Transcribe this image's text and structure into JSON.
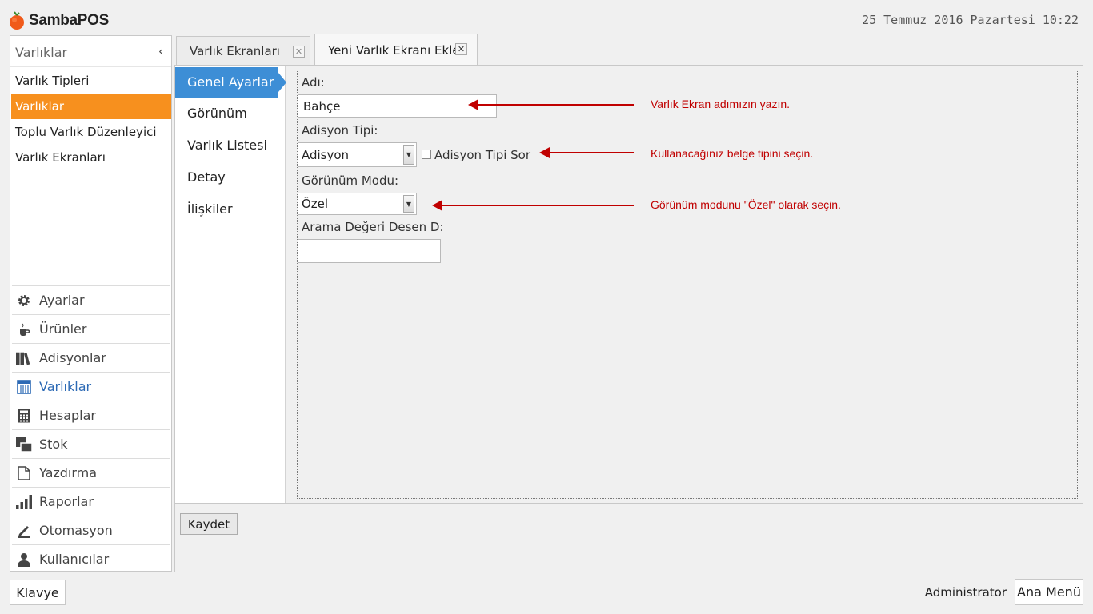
{
  "header": {
    "app_name": "SambaPOS",
    "datetime": "25 Temmuz 2016 Pazartesi 10:22"
  },
  "left_panel": {
    "title": "Varlıklar",
    "items": [
      {
        "label": "Varlık Tipleri",
        "active": false
      },
      {
        "label": "Varlıklar",
        "active": true
      },
      {
        "label": "Toplu Varlık Düzenleyici",
        "active": false
      },
      {
        "label": "Varlık Ekranları",
        "active": false
      }
    ],
    "nav": [
      {
        "label": "Ayarlar",
        "icon": "gear-icon"
      },
      {
        "label": "Ürünler",
        "icon": "cup-icon"
      },
      {
        "label": "Adisyonlar",
        "icon": "books-icon"
      },
      {
        "label": "Varlıklar",
        "icon": "table-icon",
        "active": true
      },
      {
        "label": "Hesaplar",
        "icon": "calculator-icon"
      },
      {
        "label": "Stok",
        "icon": "stock-icon"
      },
      {
        "label": "Yazdırma",
        "icon": "document-icon"
      },
      {
        "label": "Raporlar",
        "icon": "bar-chart-icon"
      },
      {
        "label": "Otomasyon",
        "icon": "pen-icon"
      },
      {
        "label": "Kullanıcılar",
        "icon": "user-icon"
      }
    ]
  },
  "tabs": [
    {
      "label": "Varlık Ekranları",
      "active": false
    },
    {
      "label": "Yeni Varlık Ekranı Ekle",
      "active": true
    }
  ],
  "subnav": [
    {
      "label": "Genel Ayarlar",
      "active": true
    },
    {
      "label": "Görünüm"
    },
    {
      "label": "Varlık Listesi"
    },
    {
      "label": "Detay"
    },
    {
      "label": "İlişkiler"
    }
  ],
  "form": {
    "name_label": "Adı:",
    "name_value": "Bahçe",
    "ticket_type_label": "Adisyon Tipi:",
    "ticket_type_value": "Adisyon",
    "ask_ticket_type_label": "Adisyon Tipi Sor",
    "ask_ticket_type_checked": false,
    "view_mode_label": "Görünüm Modu:",
    "view_mode_value": "Özel",
    "search_pattern_label": "Arama Değeri Desen D:",
    "search_pattern_value": ""
  },
  "annotations": [
    "Varlık Ekran adımızın yazın.",
    "Kullanacağınız belge tipini seçin.",
    "Görünüm modunu \"Özel\" olarak seçin."
  ],
  "footer": {
    "save_label": "Kaydet",
    "keyboard_label": "Klavye",
    "user_label": "Administrator",
    "main_menu_label": "Ana Menü"
  },
  "colors": {
    "accent_orange": "#f7901e",
    "accent_blue": "#3d8ed6",
    "annotation_red": "#c00000"
  }
}
